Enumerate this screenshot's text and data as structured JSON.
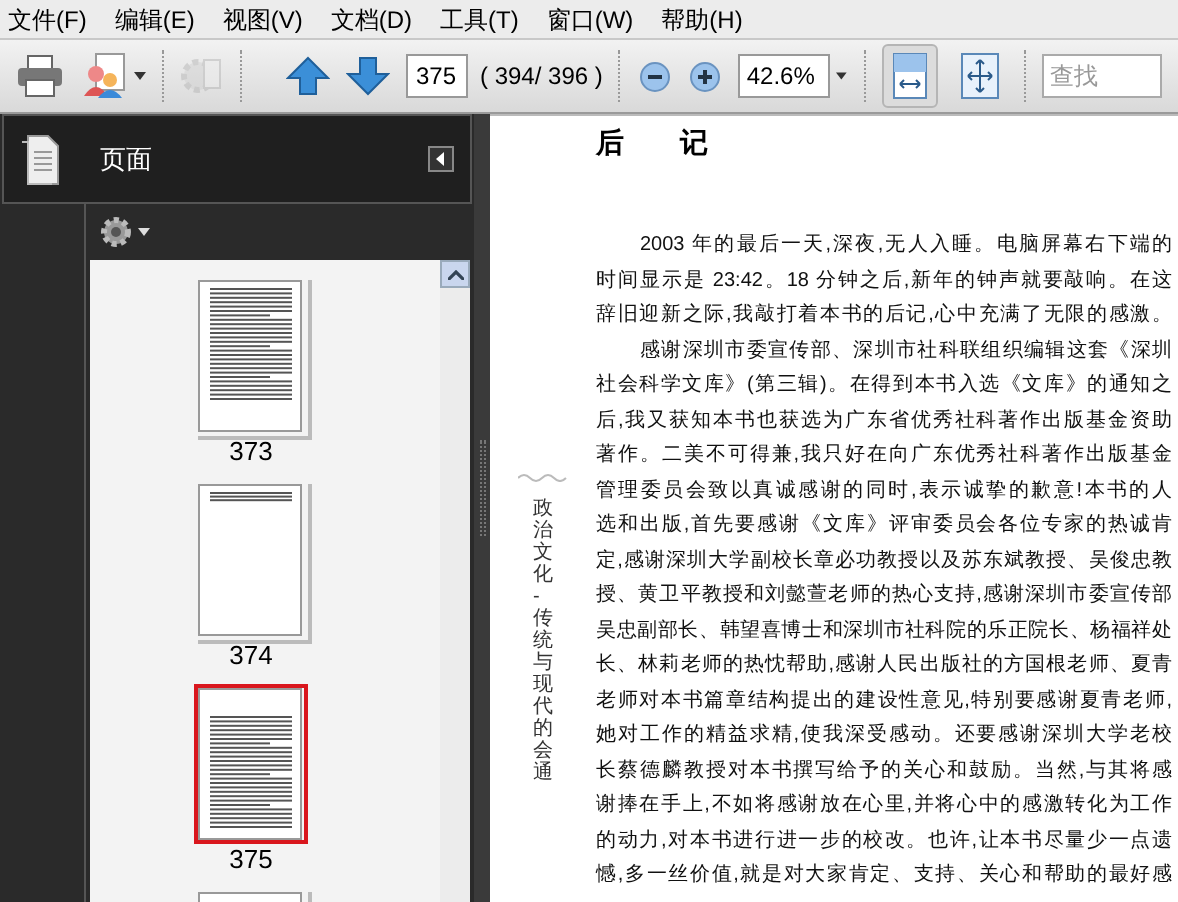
{
  "menu": [
    "文件(F)",
    "编辑(E)",
    "视图(V)",
    "文档(D)",
    "工具(T)",
    "窗口(W)",
    "帮助(H)"
  ],
  "toolbar": {
    "page_field": "375",
    "page_count": "( 394/ 396 )",
    "zoom_field": "42.6%",
    "search_placeholder": "查找",
    "reuse_disabled": true,
    "view_buttons": [
      {
        "kind": "fit-page",
        "selected": true
      },
      {
        "kind": "full-screen",
        "selected": false
      }
    ]
  },
  "sidebar": {
    "title": "页面",
    "thumbnails": [
      {
        "kind": "full",
        "label": "373",
        "selected": false
      },
      {
        "kind": "short",
        "label": "374",
        "selected": false
      },
      {
        "kind": "full",
        "label": "375",
        "selected": true
      },
      {
        "kind": "cut",
        "selected": false
      }
    ]
  },
  "document": {
    "title": "后　　记",
    "margin_text": "政治文化 -传统与现代的会通",
    "paragraphs": [
      {
        "lines": [
          "2003 年的最后一天,深夜,无人入睡。电脑屏幕右下端的",
          "时间显示是 23:42。18 分钟之后,新年的钟声就要敲响。在这",
          "辞旧迎新之际,我敲打着本书的后记,心中充满了无限的感激。"
        ]
      },
      {
        "lines": [
          "感谢深圳市委宣传部、深圳市社科联组织编辑这套《深圳",
          "社会科学文库》(第三辑)。在得到本书入选《文库》的通知之",
          "后,我又获知本书也获选为广东省优秀社科著作出版基金资助",
          "著作。二美不可得兼,我只好在向广东优秀社科著作出版基金",
          "管理委员会致以真诚感谢的同时,表示诚挚的歉意!本书的人",
          "选和出版,首先要感谢《文库》评审委员会各位专家的热诚肯",
          "定,感谢深圳大学副校长章必功教授以及苏东斌教授、吴俊忠教",
          "授、黄卫平教授和刘懿萱老师的热心支持,感谢深圳市委宣传部",
          "吴忠副部长、韩望喜博士和深圳市社科院的乐正院长、杨福祥处",
          "长、林莉老师的热忱帮助,感谢人民出版社的方国根老师、夏青",
          "老师对本书篇章结构提出的建设性意见,特别要感谢夏青老师,",
          "她对工作的精益求精,使我深受感动。还要感谢深圳大学老校",
          "长蔡德麟教授对本书撰写给予的关心和鼓励。当然,与其将感",
          "谢捧在手上,不如将感谢放在心里,并将心中的感激转化为工作",
          "的动力,对本书进行进一步的校改。也许,让本书尽量少一点遗",
          "憾,多一丝价值,就是对大家肯定、支持、关心和帮助的最好感"
        ]
      }
    ]
  }
}
